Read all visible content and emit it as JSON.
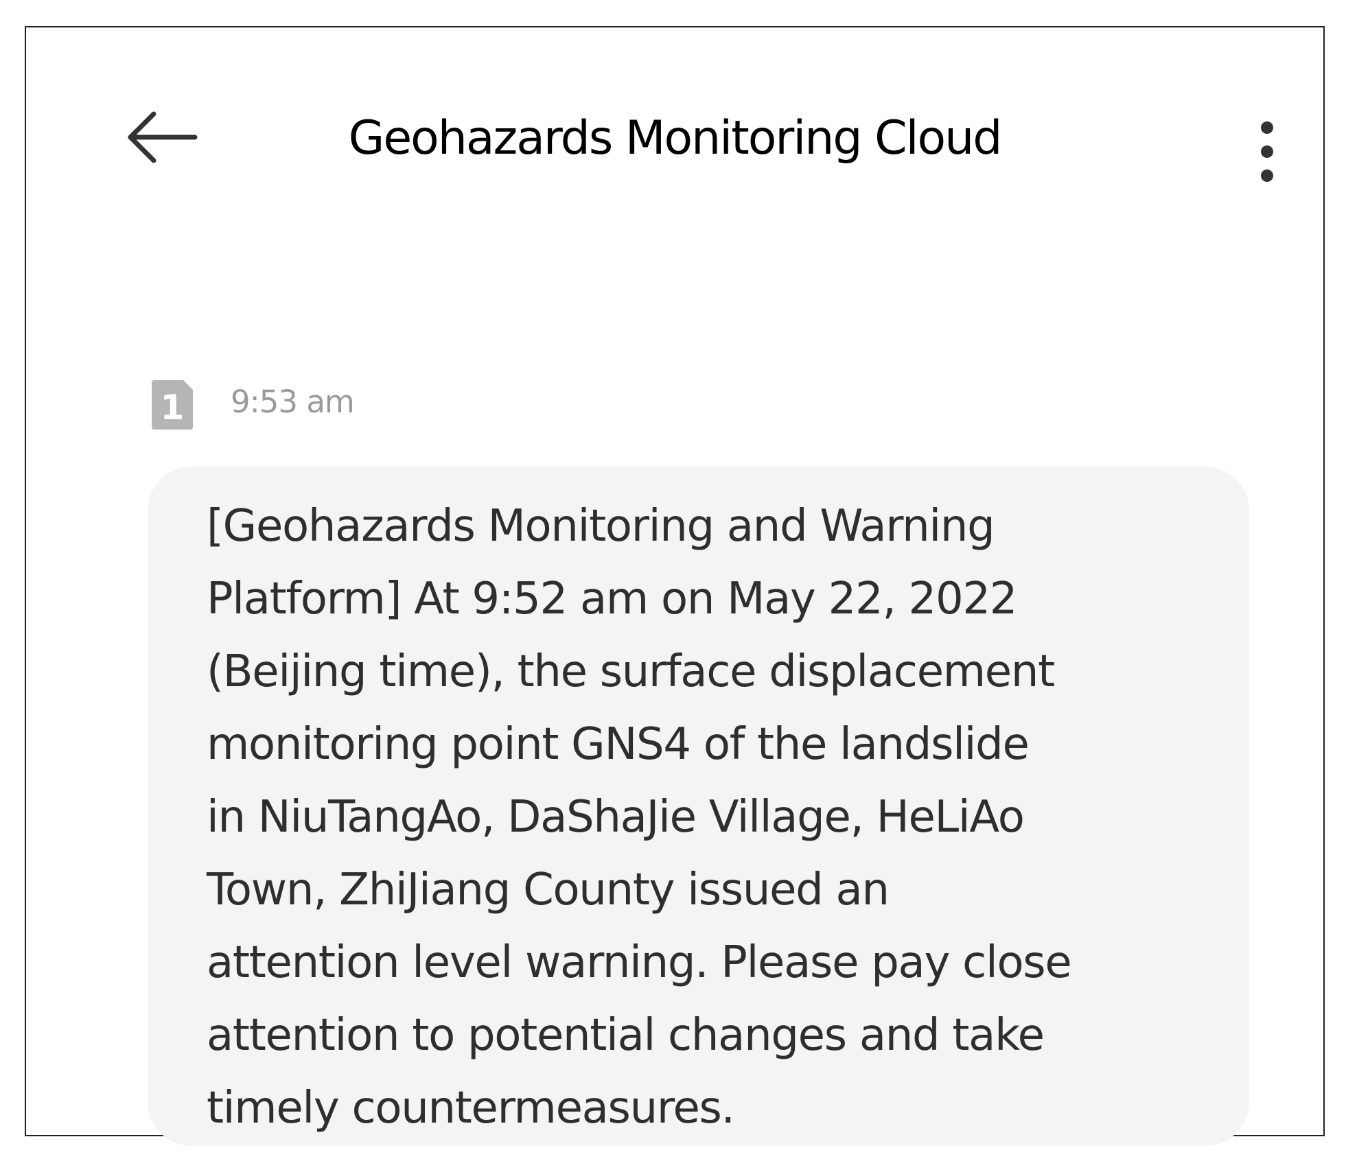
{
  "header": {
    "title": "Geohazards Monitoring Cloud",
    "back_icon": "arrow-left-icon",
    "menu_icon": "more-vertical-icon"
  },
  "message": {
    "sim_icon": "sim-1-icon",
    "sim_label": "1",
    "time": "9:53 am",
    "lines": [
      "[Geohazards Monitoring and Warning",
      "Platform] At 9:52 am on May 22, 2022",
      "(Beijing time), the surface displacement",
      "monitoring point GNS4 of the landslide",
      "in NiuTangAo, DaShaJie Village, HeLiAo",
      "Town, ZhiJiang County issued an",
      "attention level warning. Please pay close",
      "attention to potential changes and take",
      "timely countermeasures."
    ]
  },
  "colors": {
    "bubble_background": "#f4f4f4",
    "time_text": "#9a9a9a",
    "message_text": "#2e2e2e",
    "frame_border": "#222222"
  }
}
